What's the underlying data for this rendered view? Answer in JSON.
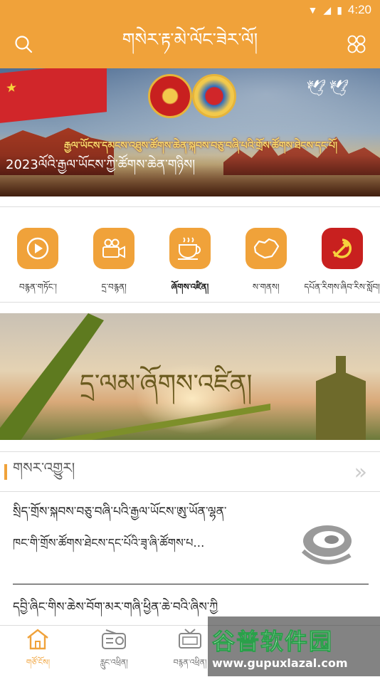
{
  "status_bar": {
    "time": "4:20"
  },
  "header": {
    "title": "གསེར་རྟ་མེ་ལོང་ཟེར་ལོ།"
  },
  "banner": {
    "slogan": "རྒྱལ་ཡོངས་དམངས་འཐུས་ཚོགས་ཆེན་སྐབས་བཅུ་བཞི་པའི་གྲོས་ཚོགས་ཐེངས་དང་པོ།",
    "caption": "2023ལོའི་རྒྱལ་ཡོངས་ཀྱི་ཚོགས་ཆེན་གཉིས།"
  },
  "shortcuts": [
    {
      "label": "བརྙན་གཏོང་།",
      "icon": "play-icon"
    },
    {
      "label": "དྲ་བརྙན།",
      "icon": "video-camera-icon"
    },
    {
      "label": "ཞོགས་འཛིན།",
      "icon": "tea-cup-icon"
    },
    {
      "label": "ས་གནས།",
      "icon": "map-icon"
    },
    {
      "label": "དཔོན་རིགས་ཞིབ་རིས་སློབ།",
      "icon": "party-emblem-icon"
    }
  ],
  "promo": {
    "text": "དྲ་ལམ་ཞོགས་འཛིན།"
  },
  "section": {
    "title": "གསར་འགྱུར།",
    "more": "»"
  },
  "news": [
    {
      "line1": "སྲིད་གྲོས་སྐབས་བཅུ་བཞི་པའི་རྒྱལ་ཡོངས་ཨུ་ཡོན་ལྷན་",
      "line2": "ཁང་གི་གྲོས་ཚོགས་ཐེངས་དང་པོའི་ཟྭ་ཞི་ཚོགས་པ…"
    },
    {
      "line1": "དབྱི་ཞིང་གིས་ཆེས་བོག་མར་གཞི་ཕྱིན་ཆེ་བའི་ཞིས་ཀྱི",
      "line2": ""
    }
  ],
  "tabs": [
    {
      "label": "གཙོ་ངོས།",
      "icon": "home-icon",
      "active": true
    },
    {
      "label": "རླུང་འཕྲིན།",
      "icon": "radio-icon",
      "active": false
    },
    {
      "label": "བརྙན་འཕྲིན།",
      "icon": "tv-icon",
      "active": false
    },
    {
      "label": "",
      "icon": "",
      "active": false
    },
    {
      "label": "",
      "icon": "",
      "active": false
    }
  ],
  "watermark": {
    "name": "谷普软件园",
    "url": "www.gupuxlazal.com"
  },
  "colors": {
    "accent": "#f0a23a",
    "party_red": "#c8201f"
  }
}
